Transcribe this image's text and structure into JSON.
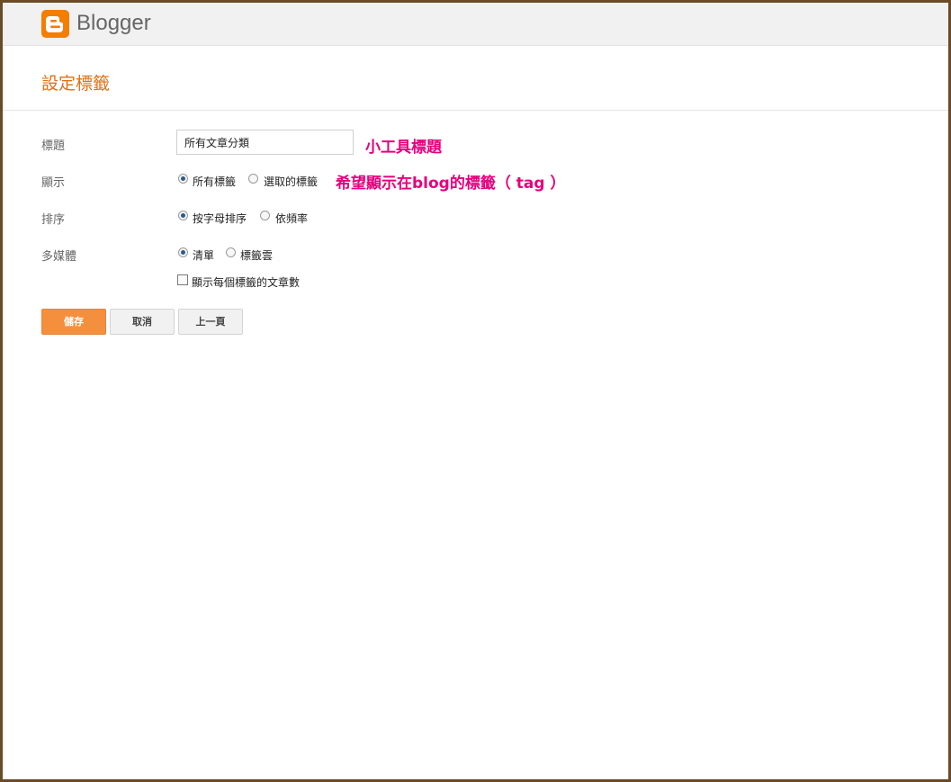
{
  "header": {
    "logo_icon": "blogger-icon",
    "app_name": "Blogger",
    "brand_color": "#f57d00"
  },
  "page": {
    "title": "設定標籤"
  },
  "form": {
    "title": {
      "label": "標題",
      "value": "所有文章分類"
    },
    "display": {
      "label": "顯示",
      "options": [
        "所有標籤",
        "選取的標籤"
      ],
      "selected": "所有標籤"
    },
    "sort": {
      "label": "排序",
      "options": [
        "按字母排序",
        "依頻率"
      ],
      "selected": "按字母排序"
    },
    "media": {
      "label": "多媒體",
      "options": [
        "清單",
        "標籤雲"
      ],
      "selected": "清單"
    },
    "show_count": {
      "label": "顯示每個標籤的文章數",
      "checked": false
    }
  },
  "buttons": {
    "save": "儲存",
    "cancel": "取消",
    "back": "上一頁"
  },
  "annotations": {
    "widget_title": "小工具標題",
    "display_hint": "希望顯示在blog的標籤（ tag ）",
    "color": "#e6007e"
  }
}
